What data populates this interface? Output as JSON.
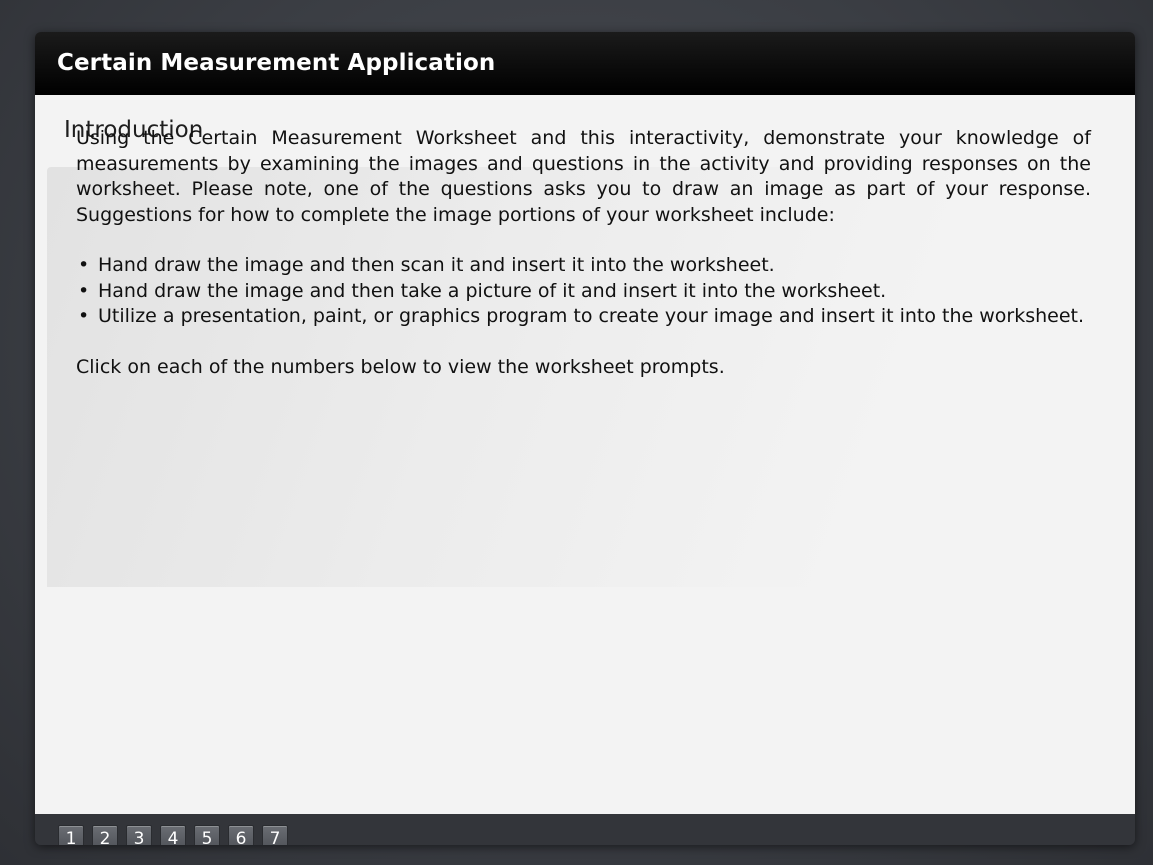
{
  "app": {
    "title": "Certain Measurement Application"
  },
  "section": {
    "title": "Introduction"
  },
  "intro": {
    "paragraph": "Using the Certain Measurement Worksheet and this interactivity, demonstrate your knowledge of measurements by examining the images and questions in the activity and providing responses on the worksheet. Please note, one of the questions asks you to draw an image as part of your response. Suggestions for how to complete the image portions of your worksheet include:",
    "bullets": [
      "Hand draw the image and then scan it and insert it into the worksheet.",
      "Hand draw the image and then take a picture of it and insert it into the worksheet.",
      "Utilize a presentation, paint, or graphics program to create your image and insert it into the worksheet."
    ],
    "closing": "Click on each of the numbers below to view the worksheet prompts."
  },
  "nav": {
    "buttons": [
      "1",
      "2",
      "3",
      "4",
      "5",
      "6",
      "7"
    ]
  }
}
